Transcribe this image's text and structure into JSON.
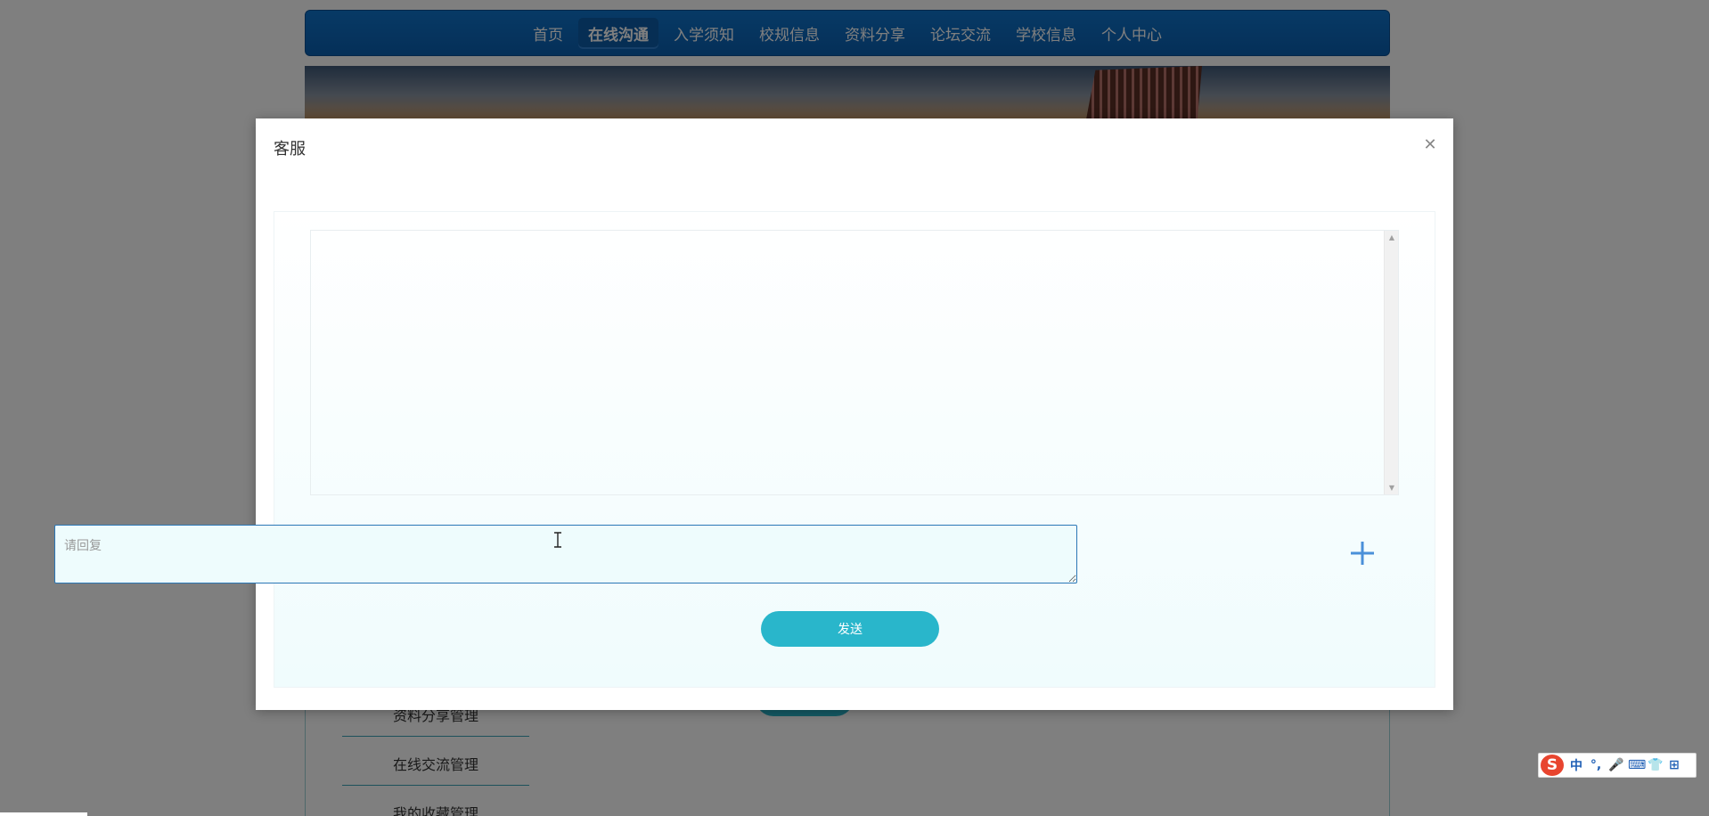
{
  "nav": {
    "items": [
      {
        "label": "首页",
        "active": false
      },
      {
        "label": "在线沟通",
        "active": true
      },
      {
        "label": "入学须知",
        "active": false
      },
      {
        "label": "校规信息",
        "active": false
      },
      {
        "label": "资料分享",
        "active": false
      },
      {
        "label": "论坛交流",
        "active": false
      },
      {
        "label": "学校信息",
        "active": false
      },
      {
        "label": "个人中心",
        "active": false
      }
    ]
  },
  "side_menu": {
    "items": [
      "资料分享管理",
      "在线交流管理",
      "我的收藏管理"
    ]
  },
  "modal": {
    "title": "客服",
    "close_icon": "close-icon",
    "reply_placeholder": "请回复",
    "add_icon": "plus-icon",
    "send_label": "发送"
  },
  "ime": {
    "logo": "S",
    "items": [
      "中",
      "°,",
      "🎤",
      "⌨",
      "👕",
      "⊞"
    ]
  },
  "colors": {
    "nav_bg": "#0a5fb0",
    "accent": "#29b6cb",
    "input_border": "#2b77b6",
    "plus": "#4a90d9"
  }
}
